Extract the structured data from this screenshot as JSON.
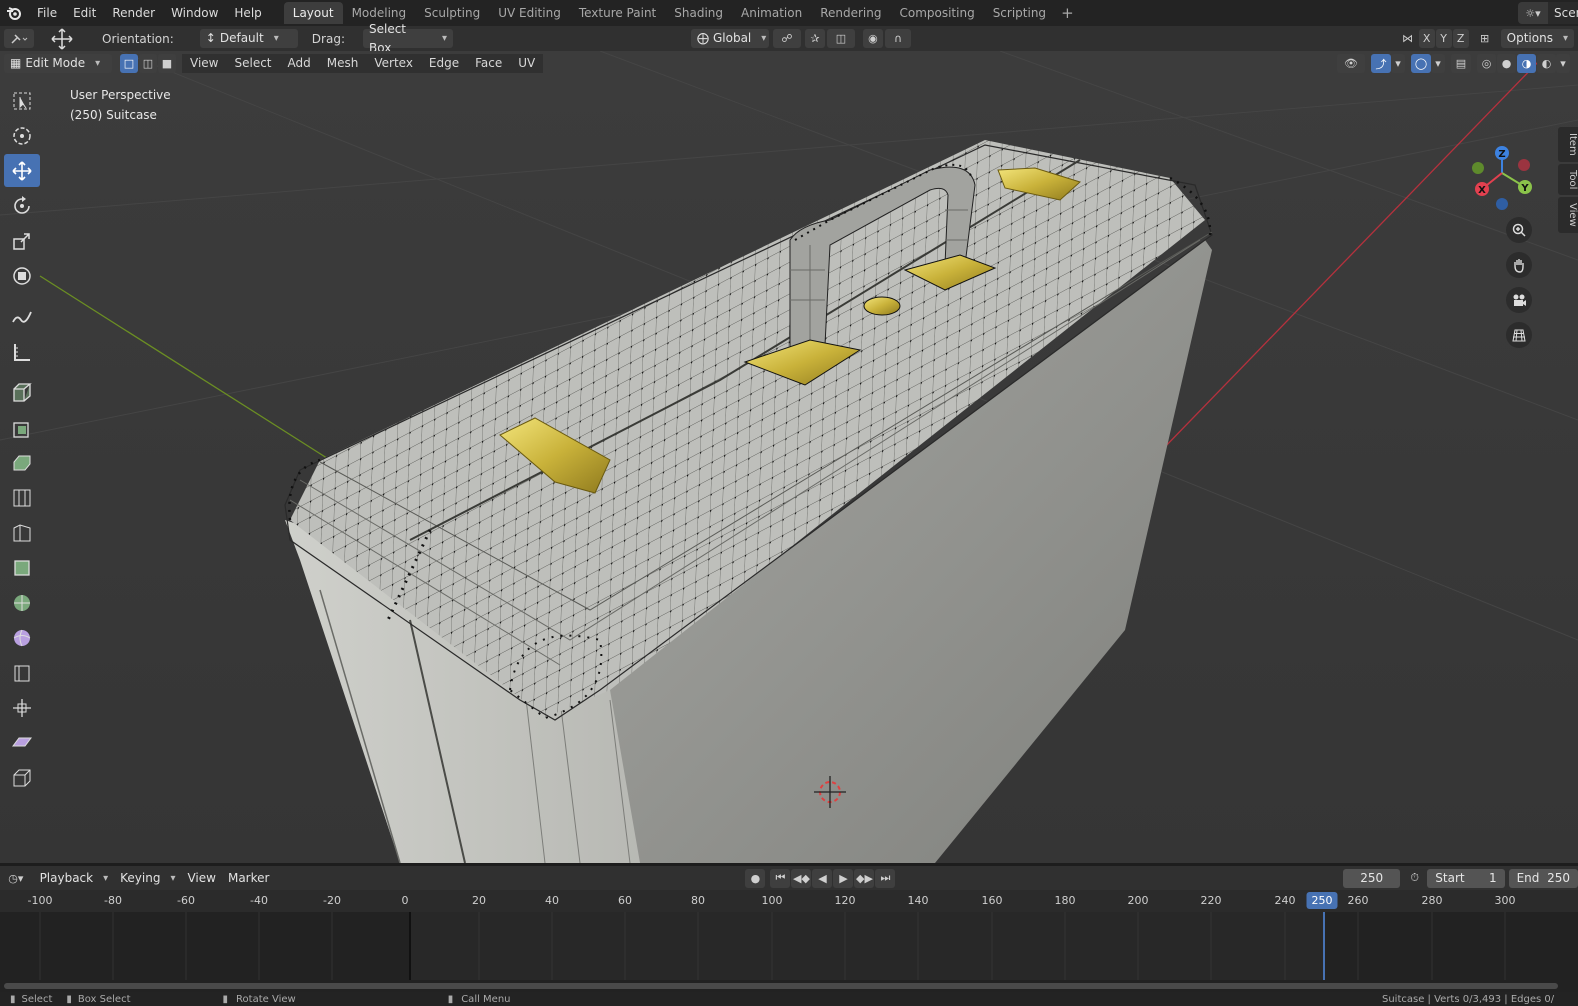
{
  "topbar": {
    "menus": [
      "File",
      "Edit",
      "Render",
      "Window",
      "Help"
    ],
    "workspaces": [
      "Layout",
      "Modeling",
      "Sculpting",
      "UV Editing",
      "Texture Paint",
      "Shading",
      "Animation",
      "Rendering",
      "Compositing",
      "Scripting"
    ],
    "active_workspace": "Layout",
    "add_tab": "+",
    "scene_label": "Scen"
  },
  "tool_header": {
    "orientation_label": "Orientation:",
    "orientation_value": "Default",
    "drag_label": "Drag:",
    "drag_value": "Select Box",
    "transform_orientation": "Global",
    "axis_x": "X",
    "axis_y": "Y",
    "axis_z": "Z",
    "options_label": "Options"
  },
  "viewport_header": {
    "mode": "Edit Mode",
    "menus": [
      "View",
      "Select",
      "Add",
      "Mesh",
      "Vertex",
      "Edge",
      "Face",
      "UV"
    ]
  },
  "viewport": {
    "perspective_label": "User Perspective",
    "object_label": "(250) Suitcase",
    "gizmo": {
      "x": "X",
      "y": "Y",
      "z": "Z"
    }
  },
  "sidebar_tabs": [
    "Item",
    "Tool",
    "View"
  ],
  "timeline": {
    "menus": [
      "Playback",
      "Keying",
      "View",
      "Marker"
    ],
    "current_frame": "250",
    "start_label": "Start",
    "start_value": "1",
    "end_label": "End",
    "end_value": "250",
    "ruler_ticks": [
      "-100",
      "-80",
      "-60",
      "-40",
      "-20",
      "0",
      "20",
      "40",
      "60",
      "80",
      "100",
      "120",
      "140",
      "160",
      "180",
      "200",
      "220",
      "240",
      "250",
      "260",
      "280",
      "300"
    ]
  },
  "statusbar": {
    "select": "Select",
    "box_select": "Box Select",
    "rotate_view": "Rotate View",
    "call_menu": "Call Menu",
    "stats": "Suitcase | Verts 0/3,493 | Edges 0/"
  },
  "colors": {
    "accent": "#4772b3",
    "x_axis": "#e2404f",
    "y_axis": "#8bc34a",
    "z_axis": "#3d82e0",
    "brass": "#d8c44a"
  }
}
